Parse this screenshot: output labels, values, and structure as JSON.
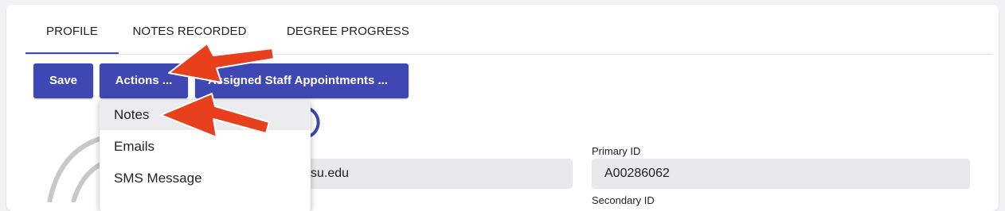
{
  "tabs": [
    {
      "label": "PROFILE",
      "active": true
    },
    {
      "label": "NOTES RECORDED",
      "active": false
    },
    {
      "label": "DEGREE PROGRESS",
      "active": false
    }
  ],
  "toolbar": {
    "save_label": "Save",
    "actions_label": "Actions ...",
    "staff_label": "Assigned Staff Appointments ..."
  },
  "actions_menu": {
    "items": [
      "Notes",
      "Emails",
      "SMS Message"
    ],
    "highlighted": "Notes"
  },
  "form": {
    "email_value": "su.edu",
    "primary_id_label": "Primary ID",
    "primary_id_value": "A00286062",
    "secondary_id_label": "Secondary ID"
  },
  "colors": {
    "accent": "#3e47b2",
    "annotation_arrow": "#e8401c"
  }
}
